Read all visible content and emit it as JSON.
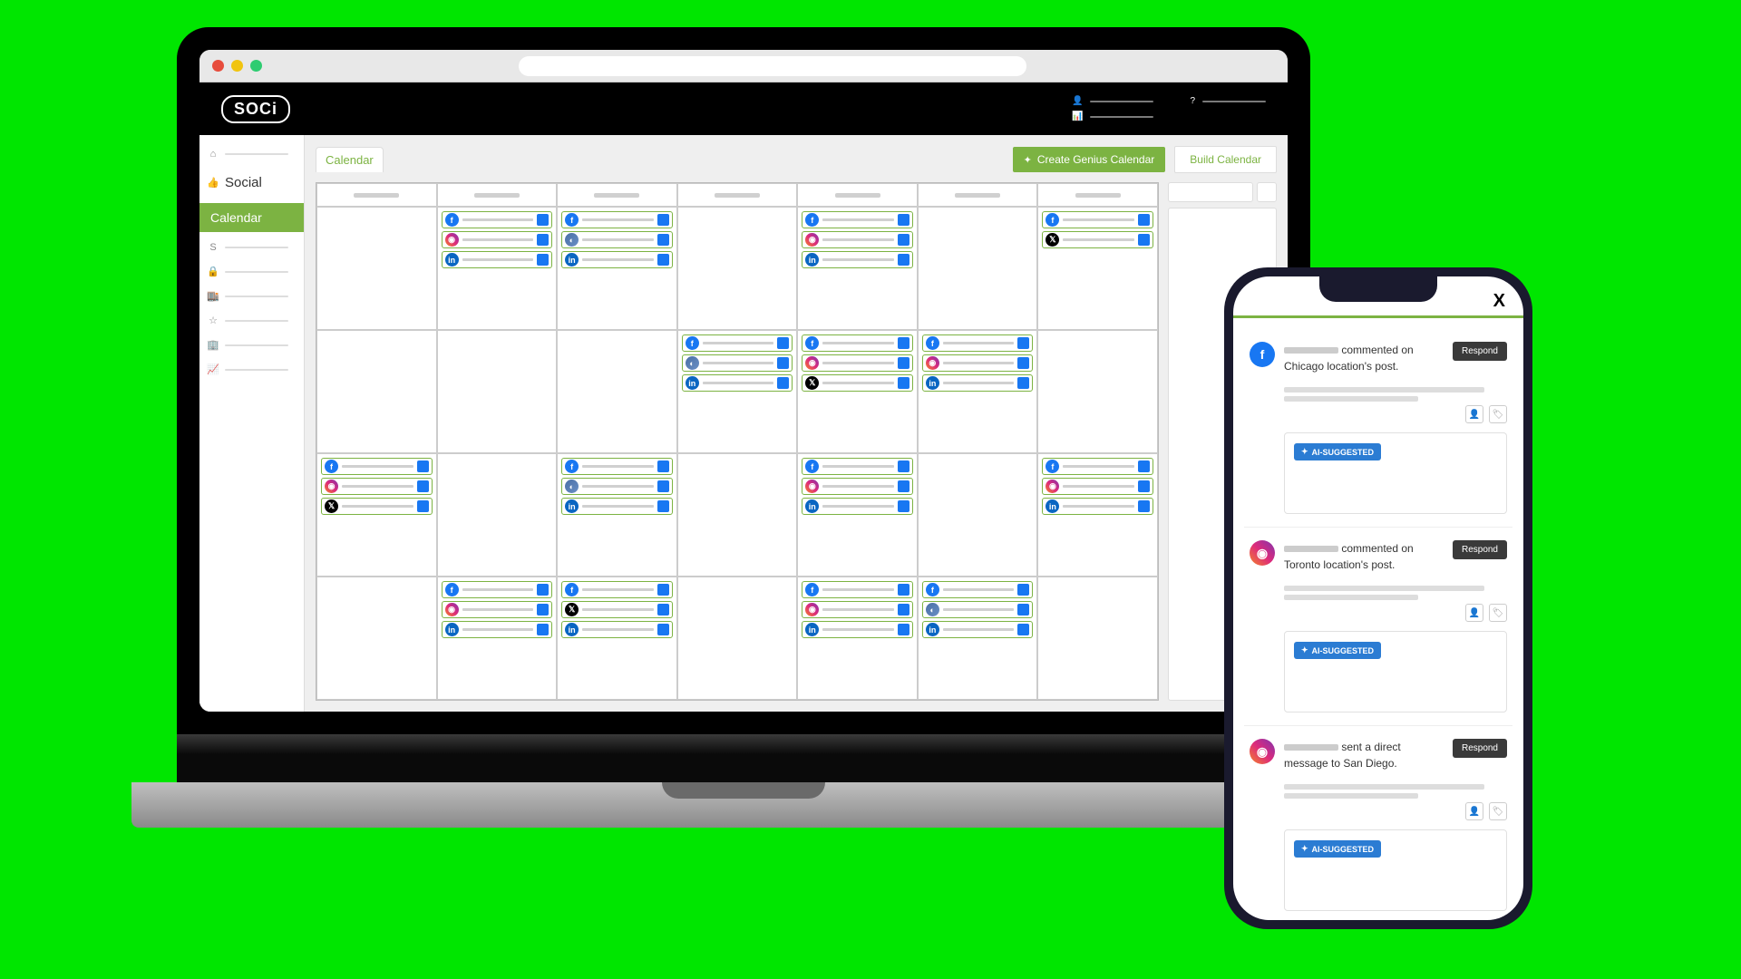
{
  "brand": "SOCi",
  "header": {
    "user_icon": "person-icon",
    "help_icon": "help-icon",
    "stats_icon": "stats-icon"
  },
  "sidebar": {
    "home": "Home",
    "social_label": "Social",
    "calendar_label": "Calendar",
    "s_label": "S"
  },
  "actions": {
    "tab": "Calendar",
    "create": "Create Genius Calendar",
    "build": "Build Calendar"
  },
  "calendar": {
    "rows": [
      [
        [],
        [
          "fb",
          "ig",
          "li"
        ],
        [
          "fb",
          "gl",
          "li"
        ],
        [],
        [
          "fb",
          "ig",
          "li"
        ],
        [],
        [
          "fb",
          "tw"
        ]
      ],
      [
        [],
        [],
        [],
        [
          "fb",
          "gl",
          "li"
        ],
        [
          "fb",
          "ig",
          "tw"
        ],
        [
          "fb",
          "ig",
          "li"
        ],
        []
      ],
      [
        [
          "fb",
          "ig",
          "tw"
        ],
        [],
        [
          "fb",
          "gl",
          "li"
        ],
        [],
        [
          "fb",
          "ig",
          "li"
        ],
        [],
        [
          "fb",
          "ig",
          "li"
        ]
      ],
      [
        [],
        [
          "fb",
          "ig",
          "li"
        ],
        [
          "fb",
          "tw",
          "li"
        ],
        [],
        [
          "fb",
          "ig",
          "li"
        ],
        [
          "fb",
          "gl",
          "li"
        ],
        []
      ]
    ]
  },
  "phone": {
    "close": "X",
    "ai_label": "AI-SUGGESTED",
    "respond": "Respond",
    "notifications": [
      {
        "platform": "fb",
        "text_suffix": " commented on Chicago location's post."
      },
      {
        "platform": "ig",
        "text_suffix": " commented on Toronto location's post."
      },
      {
        "platform": "ig",
        "text_suffix": " sent a direct message to San Diego."
      }
    ]
  }
}
